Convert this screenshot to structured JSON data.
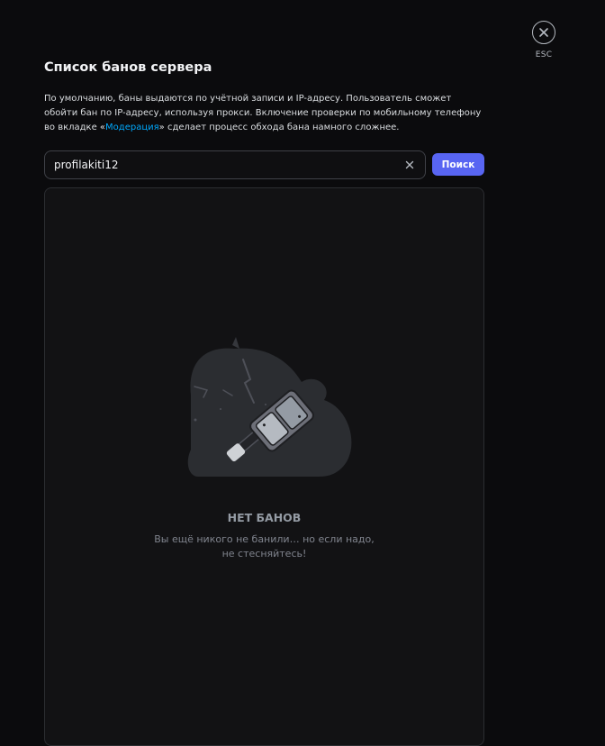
{
  "close": {
    "label": "ESC",
    "icon": "close-icon"
  },
  "header": {
    "title": "Список банов сервера"
  },
  "description": {
    "text_before": "По умолчанию, баны выдаются по учётной записи и IP-адресу. Пользователь сможет обойти бан по IP-адресу, используя прокси. Включение проверки по мобильному телефону во вкладке «",
    "link_text": "Модерация",
    "text_after": "» сделает процесс обхода бана намного сложнее."
  },
  "search": {
    "value": "profilakiti12",
    "clear_icon": "clear-icon",
    "button_label": "Поиск"
  },
  "empty_state": {
    "illustration": "ban-hammer-illustration",
    "title": "НЕТ БАНОВ",
    "line1": "Вы ещё никого не банили… но если надо,",
    "line2": "не стесняйтесь!"
  },
  "colors": {
    "accent": "#5865f2",
    "link": "#00a8fc",
    "background": "#0b0b0d",
    "panel": "#121214"
  }
}
